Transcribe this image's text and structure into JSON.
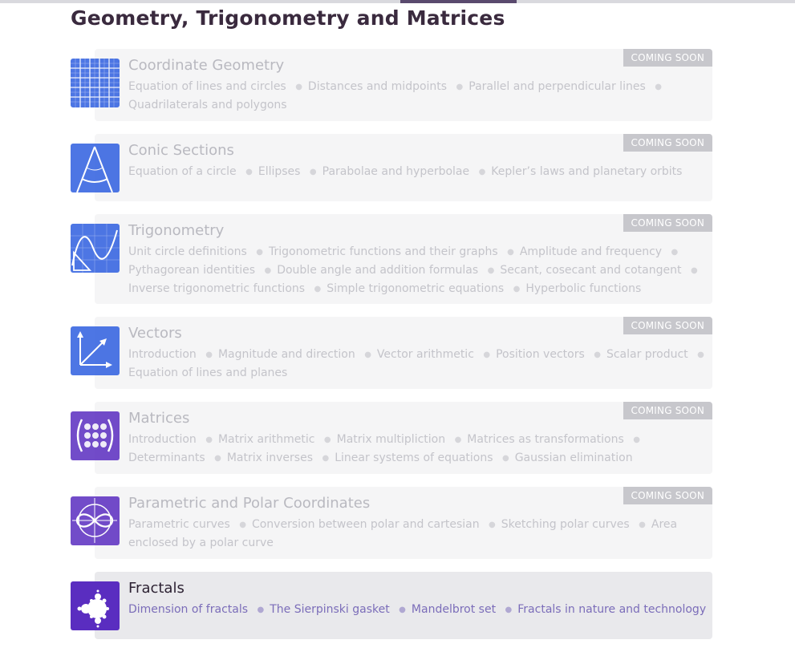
{
  "page": {
    "section_title": "Geometry, Trigonometry and Matrices"
  },
  "colors": {
    "accent": "#5a4a6e",
    "badge": "#c7c7cc",
    "link": "#7b6db9",
    "icon_blue": "#2f5fe0",
    "icon_purple": "#5a2dc0"
  },
  "courses": [
    {
      "title": "Coordinate Geometry",
      "icon": "grid-icon",
      "badge": "COMING SOON",
      "topics": [
        "Equation of lines and circles",
        "Distances and midpoints",
        "Parallel and perpendicular lines",
        "Quadrilaterals and polygons"
      ]
    },
    {
      "title": "Conic Sections",
      "icon": "cone-icon",
      "badge": "COMING SOON",
      "topics": [
        "Equation of a circle",
        "Ellipses",
        "Parabolae and hyperbolae",
        "Kepler’s laws and planetary orbits"
      ]
    },
    {
      "title": "Trigonometry",
      "icon": "sine-wave-icon",
      "badge": "COMING SOON",
      "topics": [
        "Unit circle definitions",
        "Trigonometric functions and their graphs",
        "Amplitude and frequency",
        "Pythagorean identities",
        "Double angle and addition formulas",
        "Secant, cosecant and cotangent",
        "Inverse trigonometric functions",
        "Simple trigonometric equations",
        "Hyperbolic functions"
      ]
    },
    {
      "title": "Vectors",
      "icon": "vector-arrows-icon",
      "badge": "COMING SOON",
      "topics": [
        "Introduction",
        "Magnitude and direction",
        "Vector arithmetic",
        "Position vectors",
        "Scalar product",
        "Equation of lines and planes"
      ]
    },
    {
      "title": "Matrices",
      "icon": "matrix-icon",
      "badge": "COMING SOON",
      "topics": [
        "Introduction",
        "Matrix arithmetic",
        "Matrix multipliction",
        "Matrices as transformations",
        "Determinants",
        "Matrix inverses",
        "Linear systems of equations",
        "Gaussian elimination"
      ]
    },
    {
      "title": "Parametric and Polar Coordinates",
      "icon": "infinity-curve-icon",
      "badge": "COMING SOON",
      "topics": [
        "Parametric curves",
        "Conversion between polar and cartesian",
        "Sketching polar curves",
        "Area enclosed by a polar curve"
      ]
    },
    {
      "title": "Fractals",
      "icon": "mandelbrot-icon",
      "badge": "",
      "topics": [
        "Dimension of fractals",
        "The Sierpinski gasket",
        "Mandelbrot set",
        "Fractals in nature and technology"
      ]
    }
  ]
}
